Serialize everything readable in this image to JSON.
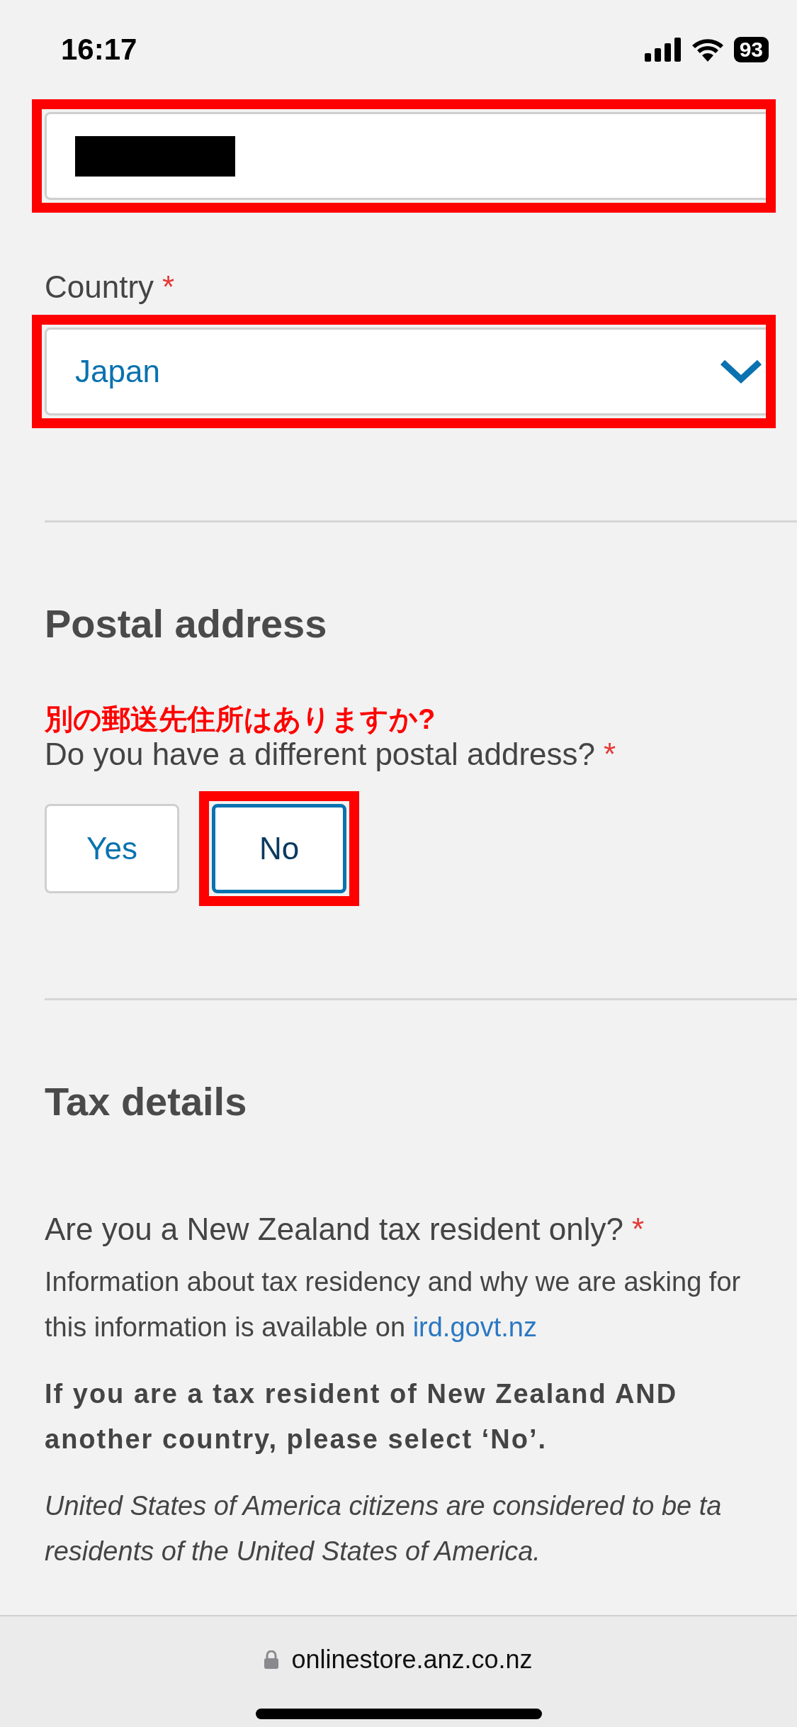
{
  "status_bar": {
    "time": "16:17",
    "battery": "93"
  },
  "address_field": {
    "redacted": true,
    "highlighted": true
  },
  "country": {
    "label": "Country",
    "required_mark": "*",
    "value": "Japan",
    "highlighted": true
  },
  "postal_section": {
    "heading": "Postal address",
    "annotation": "別の郵送先住所はありますか?",
    "question": "Do you have a different postal address?",
    "required_mark": "*",
    "options": [
      {
        "label": "Yes",
        "selected": false,
        "highlighted": false
      },
      {
        "label": "No",
        "selected": true,
        "highlighted": true
      }
    ]
  },
  "tax_section": {
    "heading": "Tax details",
    "question": "Are you a New Zealand tax resident only?",
    "required_mark": "*",
    "info": "Information about tax residency and why we are asking for this information is available on",
    "info_link": "ird.govt.nz",
    "bold_note": "If you are a tax resident of New Zealand AND another country, please select ‘No’.",
    "italic_note_lines": [
      "United States of America citizens are considered to be ta",
      "residents of the United States of America."
    ]
  },
  "browser_bar": {
    "url": "onlinestore.anz.co.nz"
  }
}
